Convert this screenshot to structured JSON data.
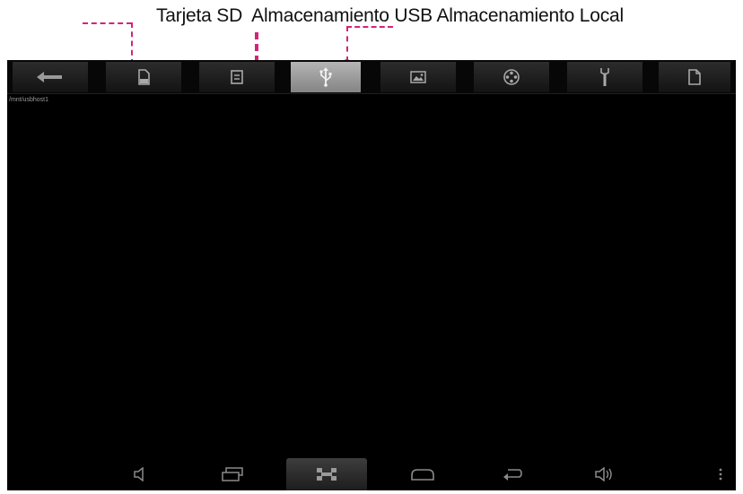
{
  "callout": {
    "labels": [
      "Tarjeta SD",
      " Almacenamiento USB",
      "Almacenamiento Local"
    ],
    "color": "#d4237a"
  },
  "toolbar": {
    "active_index": 3,
    "buttons": [
      {
        "icon": "back-arrow-icon"
      },
      {
        "icon": "sd-card-icon"
      },
      {
        "icon": "local-storage-icon"
      },
      {
        "icon": "usb-icon"
      },
      {
        "icon": "picture-icon"
      },
      {
        "icon": "video-reel-icon"
      },
      {
        "icon": "tools-icon"
      },
      {
        "icon": "document-icon"
      }
    ]
  },
  "content": {
    "path": "/mnt/usbhost1",
    "background": "#000000"
  },
  "navbar": {
    "buttons": [
      {
        "icon": "volume-down-icon"
      },
      {
        "icon": "recent-apps-icon"
      },
      {
        "icon": "screenshot-icon"
      },
      {
        "icon": "home-icon"
      },
      {
        "icon": "back-icon"
      },
      {
        "icon": "volume-up-icon"
      },
      {
        "icon": "menu-dots-icon"
      }
    ]
  }
}
